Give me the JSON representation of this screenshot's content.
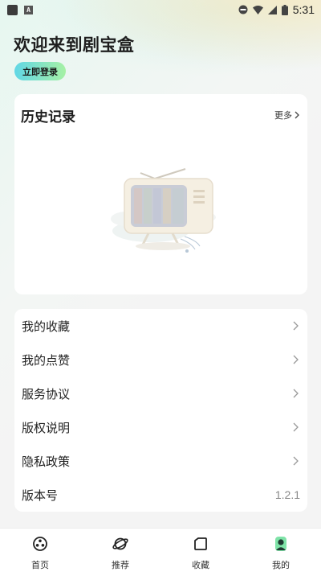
{
  "status_bar": {
    "time": "5:31",
    "icons": [
      "app-square-icon",
      "a-badge-icon",
      "do-not-disturb-icon",
      "wifi-icon",
      "signal-icon",
      "battery-icon"
    ]
  },
  "header": {
    "welcome": "欢迎来到剧宝盒",
    "login_label": "立即登录"
  },
  "history": {
    "title": "历史记录",
    "more_label": "更多"
  },
  "menu": {
    "items": [
      {
        "label": "我的收藏"
      },
      {
        "label": "我的点赞"
      },
      {
        "label": "服务协议"
      },
      {
        "label": "版权说明"
      },
      {
        "label": "隐私政策"
      }
    ],
    "version_label": "版本号",
    "version_value": "1.2.1"
  },
  "bottom_nav": {
    "items": [
      {
        "label": "首页",
        "icon": "film-reel-icon"
      },
      {
        "label": "推荐",
        "icon": "planet-icon"
      },
      {
        "label": "收藏",
        "icon": "folder-icon"
      },
      {
        "label": "我的",
        "icon": "user-icon"
      }
    ]
  },
  "colors": {
    "login_gradient_start": "#61d7e6",
    "login_gradient_end": "#a6f1a4",
    "page_background": "#f4f4f4",
    "card_background": "#ffffff"
  }
}
